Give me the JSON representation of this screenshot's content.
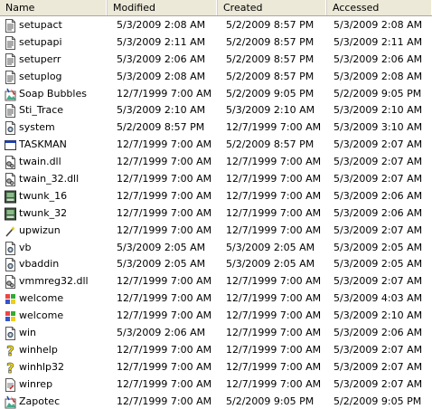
{
  "columns": {
    "name": "Name",
    "modified": "Modified",
    "created": "Created",
    "accessed": "Accessed"
  },
  "files": [
    {
      "name": "setupact",
      "modified": "5/3/2009 2:08 AM",
      "created": "5/2/2009 8:57 PM",
      "accessed": "5/3/2009 2:08 AM",
      "icon": "text-file-icon"
    },
    {
      "name": "setupapi",
      "modified": "5/3/2009 2:11 AM",
      "created": "5/2/2009 8:57 PM",
      "accessed": "5/3/2009 2:11 AM",
      "icon": "text-file-icon"
    },
    {
      "name": "setuperr",
      "modified": "5/3/2009 2:06 AM",
      "created": "5/2/2009 8:57 PM",
      "accessed": "5/3/2009 2:06 AM",
      "icon": "text-file-icon"
    },
    {
      "name": "setuplog",
      "modified": "5/3/2009 2:08 AM",
      "created": "5/2/2009 8:57 PM",
      "accessed": "5/3/2009 2:08 AM",
      "icon": "text-file-icon"
    },
    {
      "name": "Soap Bubbles",
      "modified": "12/7/1999 7:00 AM",
      "created": "5/2/2009 9:05 PM",
      "accessed": "5/2/2009 9:05 PM",
      "icon": "paint-image-icon"
    },
    {
      "name": "Sti_Trace",
      "modified": "5/3/2009 2:10 AM",
      "created": "5/3/2009 2:10 AM",
      "accessed": "5/3/2009 2:10 AM",
      "icon": "text-file-icon"
    },
    {
      "name": "system",
      "modified": "5/2/2009 8:57 PM",
      "created": "12/7/1999 7:00 AM",
      "accessed": "5/3/2009 3:10 AM",
      "icon": "settings-file-icon"
    },
    {
      "name": "TASKMAN",
      "modified": "12/7/1999 7:00 AM",
      "created": "5/2/2009 8:57 PM",
      "accessed": "5/3/2009 2:07 AM",
      "icon": "application-window-icon"
    },
    {
      "name": "twain.dll",
      "modified": "12/7/1999 7:00 AM",
      "created": "12/7/1999 7:00 AM",
      "accessed": "5/3/2009 2:07 AM",
      "icon": "dll-file-icon"
    },
    {
      "name": "twain_32.dll",
      "modified": "12/7/1999 7:00 AM",
      "created": "12/7/1999 7:00 AM",
      "accessed": "5/3/2009 2:07 AM",
      "icon": "dll-file-icon"
    },
    {
      "name": "twunk_16",
      "modified": "12/7/1999 7:00 AM",
      "created": "12/7/1999 7:00 AM",
      "accessed": "5/3/2009 2:06 AM",
      "icon": "scanner-app-icon"
    },
    {
      "name": "twunk_32",
      "modified": "12/7/1999 7:00 AM",
      "created": "12/7/1999 7:00 AM",
      "accessed": "5/3/2009 2:06 AM",
      "icon": "scanner-app-icon"
    },
    {
      "name": "upwizun",
      "modified": "12/7/1999 7:00 AM",
      "created": "12/7/1999 7:00 AM",
      "accessed": "5/3/2009 2:07 AM",
      "icon": "wand-icon"
    },
    {
      "name": "vb",
      "modified": "5/3/2009 2:05 AM",
      "created": "5/3/2009 2:05 AM",
      "accessed": "5/3/2009 2:05 AM",
      "icon": "settings-file-icon"
    },
    {
      "name": "vbaddin",
      "modified": "5/3/2009 2:05 AM",
      "created": "5/3/2009 2:05 AM",
      "accessed": "5/3/2009 2:05 AM",
      "icon": "settings-file-icon"
    },
    {
      "name": "vmmreg32.dll",
      "modified": "12/7/1999 7:00 AM",
      "created": "12/7/1999 7:00 AM",
      "accessed": "5/3/2009 2:07 AM",
      "icon": "dll-file-icon"
    },
    {
      "name": "welcome",
      "modified": "12/7/1999 7:00 AM",
      "created": "12/7/1999 7:00 AM",
      "accessed": "5/3/2009 4:03 AM",
      "icon": "windows-logo-icon"
    },
    {
      "name": "welcome",
      "modified": "12/7/1999 7:00 AM",
      "created": "12/7/1999 7:00 AM",
      "accessed": "5/3/2009 2:10 AM",
      "icon": "windows-logo-icon"
    },
    {
      "name": "win",
      "modified": "5/3/2009 2:06 AM",
      "created": "12/7/1999 7:00 AM",
      "accessed": "5/3/2009 2:06 AM",
      "icon": "settings-file-icon"
    },
    {
      "name": "winhelp",
      "modified": "12/7/1999 7:00 AM",
      "created": "12/7/1999 7:00 AM",
      "accessed": "5/3/2009 2:07 AM",
      "icon": "help-question-icon"
    },
    {
      "name": "winhlp32",
      "modified": "12/7/1999 7:00 AM",
      "created": "12/7/1999 7:00 AM",
      "accessed": "5/3/2009 2:07 AM",
      "icon": "help-question-icon"
    },
    {
      "name": "winrep",
      "modified": "12/7/1999 7:00 AM",
      "created": "12/7/1999 7:00 AM",
      "accessed": "5/3/2009 2:07 AM",
      "icon": "report-app-icon"
    },
    {
      "name": "Zapotec",
      "modified": "12/7/1999 7:00 AM",
      "created": "5/2/2009 9:05 PM",
      "accessed": "5/2/2009 9:05 PM",
      "icon": "paint-image-icon"
    }
  ]
}
